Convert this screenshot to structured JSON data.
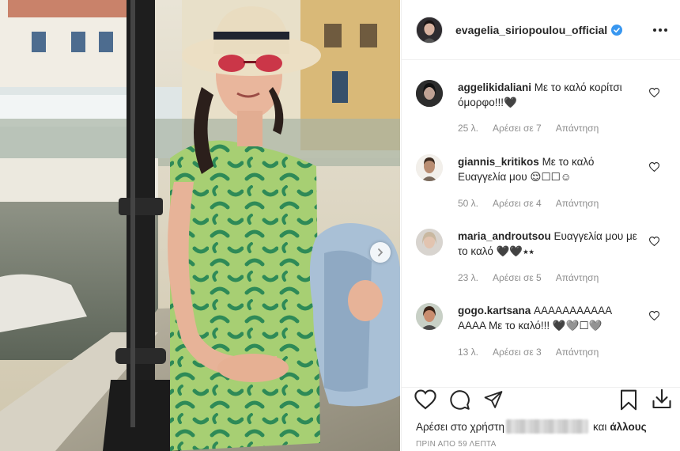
{
  "post": {
    "author": "evagelia_siriopoulou_official",
    "verified": true,
    "photo": {
      "description_icon": "photo-woman-by-lamp-post",
      "has_next": true
    }
  },
  "comments": [
    {
      "user": "aggelikidaliani",
      "text": "Με το καλό κορίτσι όμορφο!!!🖤",
      "time": "25 λ.",
      "likes": "Αρέσει σε 7",
      "reply": "Απάντηση"
    },
    {
      "user": "giannis_kritikos",
      "text": "Με το καλό Ευαγγελία μου 😌☐☐☺",
      "time": "50 λ.",
      "likes": "Αρέσει σε 4",
      "reply": "Απάντηση"
    },
    {
      "user": "maria_androutsou",
      "text": "Ευαγγελία μου με το καλό 🖤🖤⭑⭑",
      "time": "23 λ.",
      "likes": "Αρέσει σε 5",
      "reply": "Απάντηση"
    },
    {
      "user": "gogo.kartsana",
      "text": "ΑΑΑΑΑΑΑΑΑΑΑ ΑΑΑΑ Με το καλό!!! 🖤🩶☐🩶",
      "time": "13 λ.",
      "likes": "Αρέσει σε 3",
      "reply": "Απάντηση"
    }
  ],
  "likes_line": {
    "prefix": "Αρέσει στο χρήστη",
    "suffix": "και",
    "others": "άλλους"
  },
  "timestamp": "ΠΡΙΝ ΑΠΟ 59 ΛΕΠΤΑ",
  "colors": {
    "verified_blue": "#3897f0",
    "text": "#262626",
    "meta_gray": "#8e8e8e",
    "divider": "#efefef"
  }
}
